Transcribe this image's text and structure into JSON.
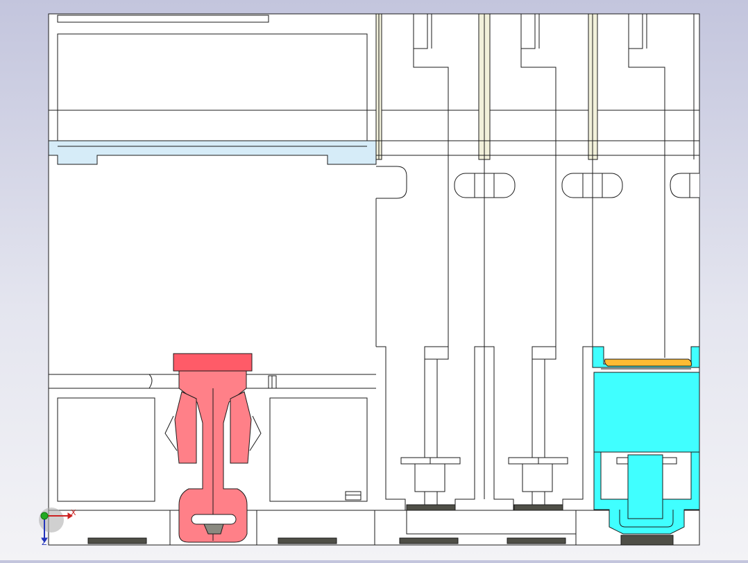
{
  "view": {
    "triad": {
      "x_axis_label": "X",
      "z_axis_label": "Z"
    }
  },
  "colors": {
    "background_top": "#c3c5dd",
    "background_bottom": "#f3f3f6",
    "body_fill": "#ffffff",
    "outline": "#1a1a1a",
    "seam_fill": "#f1f0da",
    "highlight_blue": "#d6ecf8",
    "red_latch": "#ff8088",
    "red_latch_top": "#ff5b68",
    "cyan_part": "#40ffff",
    "orange_part": "#ffbb33",
    "dark_slot": "#4f4f47",
    "triad_x": "#cc2222",
    "triad_y": "#22aa22",
    "triad_z": "#2233bb"
  },
  "components": [
    "outer-housing",
    "top-window-panel",
    "light-blue-rail",
    "left-lower-chamber",
    "red-latch-mechanism",
    "center-lower-chamber",
    "module-column-1",
    "module-column-2",
    "module-column-3",
    "cyan-terminal-block",
    "orange-contact-plate"
  ]
}
